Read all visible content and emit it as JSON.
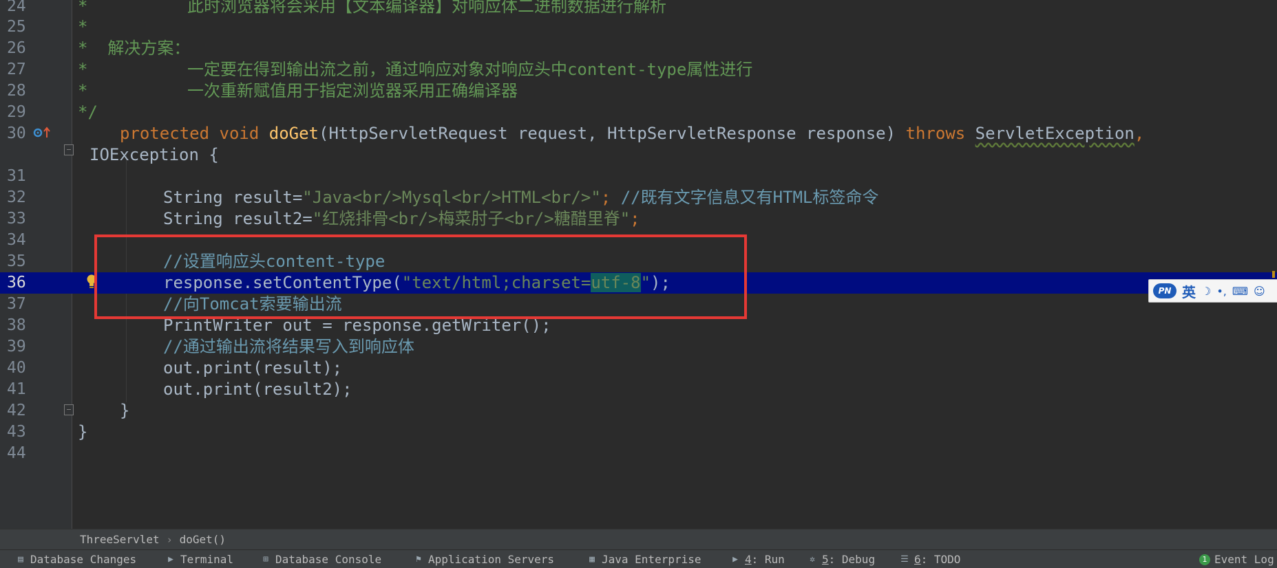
{
  "editor": {
    "lines": [
      {
        "n": "24",
        "text": "*          此时浏览器将会采用【文本编译器】对响应体二进制数据进行解析"
      },
      {
        "n": "25",
        "text": "*"
      },
      {
        "n": "26",
        "text": "*  解决方案："
      },
      {
        "n": "27",
        "text": "*          一定要在得到输出流之前，通过响应对象对响应头中content-type属性进行"
      },
      {
        "n": "28",
        "text": "*          一次重新赋值用于指定浏览器采用正确编译器"
      },
      {
        "n": "29",
        "text": "*/"
      },
      {
        "n": "30",
        "kw1": "protected void ",
        "fn": "doGet",
        "mid": "(HttpServletRequest request, HttpServletResponse response) ",
        "kw2": "throws ",
        "ex": "ServletException",
        "end": ","
      },
      {
        "n": "",
        "text": "IOException {"
      },
      {
        "n": "31",
        "text": ""
      },
      {
        "n": "32",
        "a": "String result=",
        "s": "\"Java<br/>Mysql<br/>HTML<br/>\"",
        "b": "; ",
        "c": "//既有文字信息又有HTML标签命令"
      },
      {
        "n": "33",
        "a": "String result2=",
        "s": "\"红烧排骨<br/>梅菜肘子<br/>糖醋里脊\"",
        "b": ";"
      },
      {
        "n": "34",
        "text": ""
      },
      {
        "n": "35",
        "c": "//设置响应头content-type"
      },
      {
        "n": "36",
        "a": "response.setContentType(",
        "s1": "\"text/html;charset=",
        "sel": "utf-8",
        "s2": "\"",
        "b": ");"
      },
      {
        "n": "37",
        "c": "//向Tomcat索要输出流"
      },
      {
        "n": "38",
        "text": "PrintWriter out = response.getWriter();"
      },
      {
        "n": "39",
        "c": "//通过输出流将结果写入到响应体"
      },
      {
        "n": "40",
        "text": "out.print(result);"
      },
      {
        "n": "41",
        "text": "out.print(result2);"
      },
      {
        "n": "42",
        "text": "}"
      },
      {
        "n": "43",
        "text": "}"
      },
      {
        "n": "44",
        "text": ""
      }
    ]
  },
  "ime": {
    "logo": "PN",
    "lang": "英"
  },
  "breadcrumb": {
    "class_name": "ThreeServlet",
    "method": "doGet()"
  },
  "toolwindows": {
    "db_changes": "Database Changes",
    "terminal": "Terminal",
    "db_console": "Database Console",
    "app_servers": "Application Servers",
    "java_ee": "Java Enterprise",
    "run_num": "4",
    "run": ": Run",
    "debug_num": "5",
    "debug": ": Debug",
    "todo_num": "6",
    "todo": ": TODO",
    "event_log_count": "1",
    "event_log": "Event Log"
  }
}
